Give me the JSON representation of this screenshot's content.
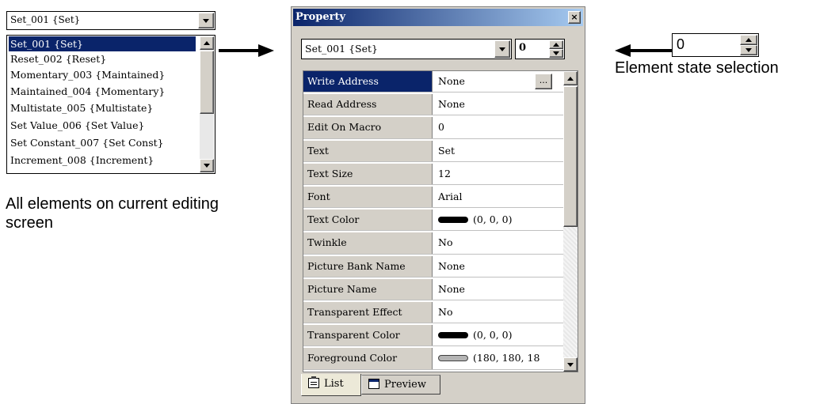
{
  "left_panel": {
    "combo_value": "Set_001 {Set}",
    "items": [
      "Set_001 {Set}",
      "Reset_002 {Reset}",
      "Momentary_003 {Maintained}",
      "Maintained_004 {Momentary}",
      "Multistate_005 {Multistate}",
      "Set Value_006 {Set Value}",
      "Set Constant_007 {Set Const}",
      "Increment_008 {Increment}"
    ],
    "selected_index": 0,
    "caption": "All elements on current editing screen"
  },
  "property_window": {
    "title": "Property",
    "close_glyph": "×",
    "combo_value": "Set_001 {Set}",
    "state_value": "0",
    "ellipsis_label": "...",
    "rows": [
      {
        "name": "Write Address",
        "value": "None"
      },
      {
        "name": "Read Address",
        "value": "None"
      },
      {
        "name": "Edit On Macro",
        "value": "0"
      },
      {
        "name": "Text",
        "value": "Set"
      },
      {
        "name": "Text Size",
        "value": "12"
      },
      {
        "name": "Font",
        "value": "Arial"
      },
      {
        "name": "Text Color",
        "value": "(0, 0, 0)",
        "swatch": "#000000"
      },
      {
        "name": "Twinkle",
        "value": "No"
      },
      {
        "name": "Picture Bank Name",
        "value": "None"
      },
      {
        "name": "Picture Name",
        "value": "None"
      },
      {
        "name": "Transparent Effect",
        "value": "No"
      },
      {
        "name": "Transparent Color",
        "value": "(0, 0, 0)",
        "swatch": "#000000"
      },
      {
        "name": "Foreground Color",
        "value": "(180, 180, 18",
        "swatch": "#b4b4b4"
      }
    ],
    "selected_row": 0,
    "tabs": {
      "list": "List",
      "preview": "Preview"
    }
  },
  "state_selector": {
    "value": "0",
    "caption": "Element state selection"
  },
  "colors": {
    "selection": "#0a246a",
    "face": "#d4d0c8"
  }
}
